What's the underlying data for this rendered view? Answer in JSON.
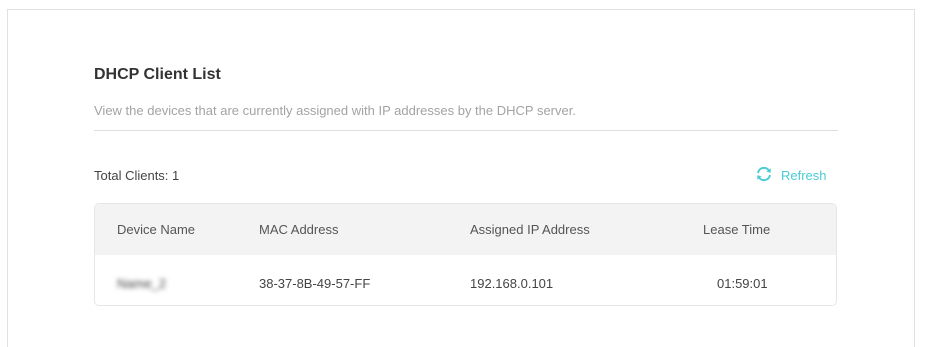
{
  "section": {
    "title": "DHCP Client List",
    "description": "View the devices that are currently assigned with IP addresses by the DHCP server."
  },
  "summary": {
    "total_clients_label": "Total Clients: 1",
    "refresh_label": "Refresh",
    "refresh_icon": "refresh-icon",
    "accent_color": "#4acbd6"
  },
  "table": {
    "columns": [
      "Device Name",
      "MAC Address",
      "Assigned IP Address",
      "Lease Time"
    ],
    "rows": [
      {
        "device_name": "Name_2",
        "mac_address": "38-37-8B-49-57-FF",
        "ip_address": "192.168.0.101",
        "lease_time": "01:59:01"
      }
    ]
  }
}
